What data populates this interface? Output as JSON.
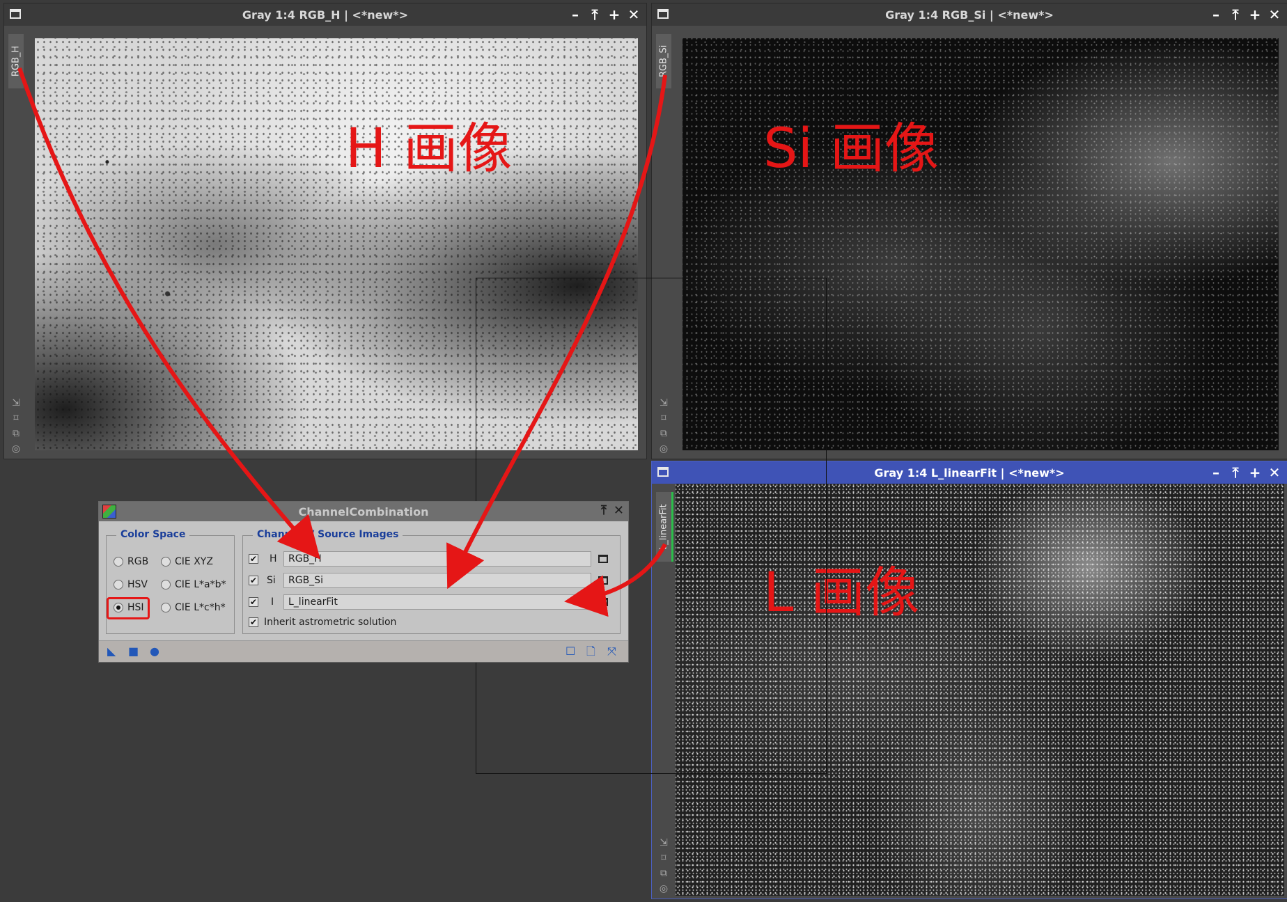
{
  "windows": {
    "h": {
      "title": "Gray 1:4 RGB_H | <*new*>",
      "tab_label": "RGB_H",
      "annotation": "H 画像"
    },
    "si": {
      "title": "Gray 1:4 RGB_Si | <*new*>",
      "tab_label": "RGB_Si",
      "annotation": "Si 画像"
    },
    "l": {
      "title": "Gray 1:4 L_linearFit | <*new*>",
      "tab_label": "L_linearFit",
      "annotation": "L 画像"
    }
  },
  "title_controls": [
    "–",
    "⤒",
    "+",
    "✕"
  ],
  "side_tools": [
    "⇲",
    "⌑",
    "⧉",
    "◎"
  ],
  "dialog": {
    "title": "ChannelCombination",
    "color_space": {
      "title": "Color Space",
      "options": [
        {
          "label": "RGB",
          "selected": false
        },
        {
          "label": "CIE XYZ",
          "selected": false
        },
        {
          "label": "HSV",
          "selected": false
        },
        {
          "label": "CIE L*a*b*",
          "selected": false
        },
        {
          "label": "HSI",
          "selected": true
        },
        {
          "label": "CIE L*c*h*",
          "selected": false
        }
      ]
    },
    "channels": {
      "title": "Channels / Source Images",
      "rows": [
        {
          "checked": true,
          "channel": "H",
          "source": "RGB_H"
        },
        {
          "checked": true,
          "channel": "Si",
          "source": "RGB_Si"
        },
        {
          "checked": true,
          "channel": "I",
          "source": "L_linearFit"
        }
      ],
      "inherit_label": "Inherit astrometric solution",
      "inherit_checked": true
    },
    "footer_left": [
      "◣",
      "■",
      "●"
    ],
    "footer_right": [
      "☐",
      "🗋",
      "⤧"
    ]
  },
  "colors": {
    "annotation": "#e51616",
    "active_title": "#3f53b6",
    "dialog_group_title": "#1a3e9a"
  }
}
